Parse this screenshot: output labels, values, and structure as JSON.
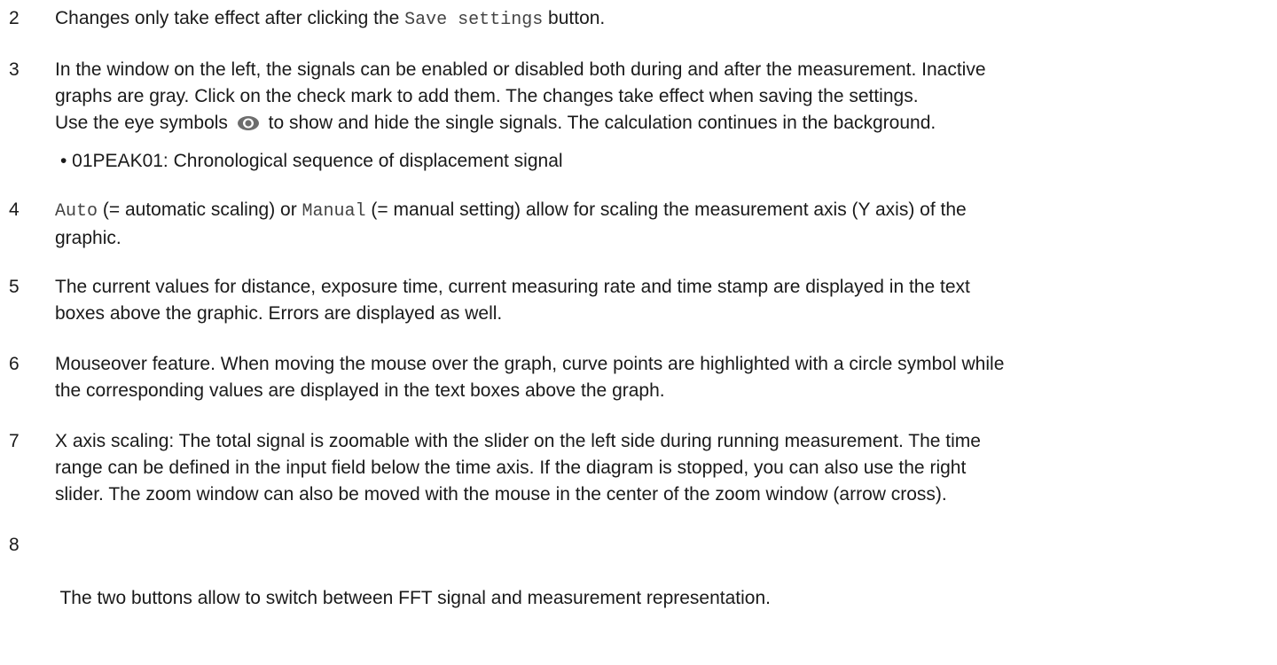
{
  "items": [
    {
      "num": "2",
      "pre": "Changes only take effect after clicking the ",
      "code": "Save settings",
      "post": " button."
    },
    {
      "num": "3",
      "line1": "In the window on the left, the signals can be enabled or disabled both during and after the measurement. Inactive",
      "line2": "graphs are gray. Click on the check mark to add them. The changes take effect when saving the settings.",
      "line3_pre": "Use the eye symbols",
      "line3_post": "to show and hide the single signals. The calculation continues in the background.",
      "bullet": "• 01PEAK01: Chronological sequence of displacement signal",
      "eye_icon": "eye-icon",
      "eye_color": "#6d6d6d"
    },
    {
      "num": "4",
      "code1": "Auto",
      "mid1": " (= automatic scaling) or ",
      "code2": "Manual",
      "mid2": " (= manual setting) allow for scaling the measurement axis (Y axis) of the",
      "line2": "graphic."
    },
    {
      "num": "5",
      "line1": "The current values for distance, exposure time, current measuring rate and time stamp are displayed in the text",
      "line2": "boxes above the graphic. Errors are displayed as well."
    },
    {
      "num": "6",
      "line1": "Mouseover feature. When moving the mouse over the graph, curve points are highlighted with a circle symbol while",
      "line2": "the corresponding values are displayed in the text boxes above the graph."
    },
    {
      "num": "7",
      "line1": "X axis scaling: The total signal is zoomable with the slider on the left side during running measurement. The time",
      "line2": "range can be defined in the input field below the time axis. If the diagram is stopped, you can also use the right",
      "line3": "slider. The zoom window can also be moved with the mouse in the center of the zoom window (arrow cross)."
    },
    {
      "num": "8",
      "line1": " The two buttons allow to switch between FFT signal and measurement representation."
    }
  ]
}
